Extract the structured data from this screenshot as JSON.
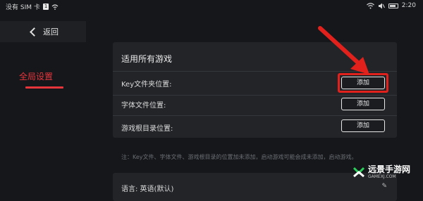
{
  "status_bar": {
    "carrier": "没有 SIM 卡",
    "sim_badge": "1",
    "time": "2:20"
  },
  "sidebar": {
    "back_label": "返回",
    "items": [
      {
        "label": "全局设置",
        "selected": true
      }
    ]
  },
  "panel": {
    "title": "适用所有游戏",
    "rows": [
      {
        "label": "Key文件夹位置:",
        "button": "添加"
      },
      {
        "label": "字体文件位置:",
        "button": "添加"
      },
      {
        "label": "游戏根目录位置:",
        "button": "添加"
      }
    ]
  },
  "note": "注：Key文件、字体文件、游戏根目录的位置加未添加，启动游戏可能会成未添加，启动游戏。",
  "language": {
    "label": "语言: 英语(默认)"
  },
  "watermark": {
    "text": "远景手游网",
    "url": "GAMEXJ.COM"
  },
  "colors": {
    "accent": "#e6353b",
    "highlight": "#e2211c",
    "panel": "#222428",
    "background": "#15171b"
  }
}
